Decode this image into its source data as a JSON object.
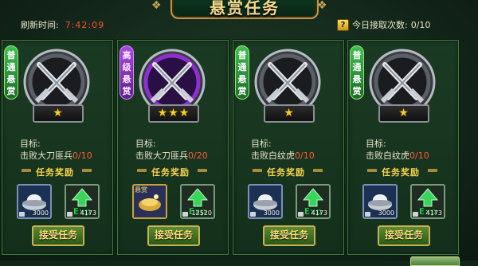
{
  "title": "悬赏任务",
  "header": {
    "refresh_label": "刷新时间:",
    "refresh_time": "7:42:09",
    "help_icon": "?",
    "daily_label": "今日接取次数:",
    "daily_count": "0/10"
  },
  "colors": {
    "accent": "#f7d54a",
    "progress_red": "#ff5a3a",
    "common_tag": "#3ec050",
    "advanced_tag": "#a84be0"
  },
  "quests": [
    {
      "tag": "普通悬赏",
      "tag_type": "common",
      "stars": "★",
      "emblem_icon": "crossed-swords-icon",
      "goal_label": "目标:",
      "goal_text": "击败大刀匪兵",
      "progress": "0/10",
      "reward_label": "任务奖励",
      "rewards": [
        {
          "icon": "silver-ingot-icon",
          "qty": "3000"
        },
        {
          "icon": "exp-icon",
          "qty": "4173"
        }
      ],
      "accept_label": "接受任务"
    },
    {
      "tag": "高级悬赏",
      "tag_type": "advanced",
      "stars": "★★★",
      "emblem_icon": "crossed-swords-icon",
      "goal_label": "目标:",
      "goal_text": "击败大刀匪兵",
      "progress": "0/20",
      "reward_label": "任务奖励",
      "rewards": [
        {
          "icon": "treasure-item-icon",
          "qty": "",
          "tag": "悬赏"
        },
        {
          "icon": "exp-icon",
          "qty": "12520"
        }
      ],
      "accept_label": "接受任务"
    },
    {
      "tag": "普通悬赏",
      "tag_type": "common",
      "stars": "★",
      "emblem_icon": "crossed-swords-icon",
      "goal_label": "目标:",
      "goal_text": "击败白纹虎",
      "progress": "0/10",
      "reward_label": "任务奖励",
      "rewards": [
        {
          "icon": "silver-ingot-icon",
          "qty": "3000"
        },
        {
          "icon": "exp-icon",
          "qty": "4173"
        }
      ],
      "accept_label": "接受任务"
    },
    {
      "tag": "普通悬赏",
      "tag_type": "common",
      "stars": "★",
      "emblem_icon": "crossed-swords-icon",
      "goal_label": "目标:",
      "goal_text": "击败白纹虎",
      "progress": "0/10",
      "reward_label": "任务奖励",
      "rewards": [
        {
          "icon": "silver-ingot-icon",
          "qty": "3000"
        },
        {
          "icon": "exp-icon",
          "qty": "4173"
        }
      ],
      "accept_label": "接受任务"
    }
  ]
}
